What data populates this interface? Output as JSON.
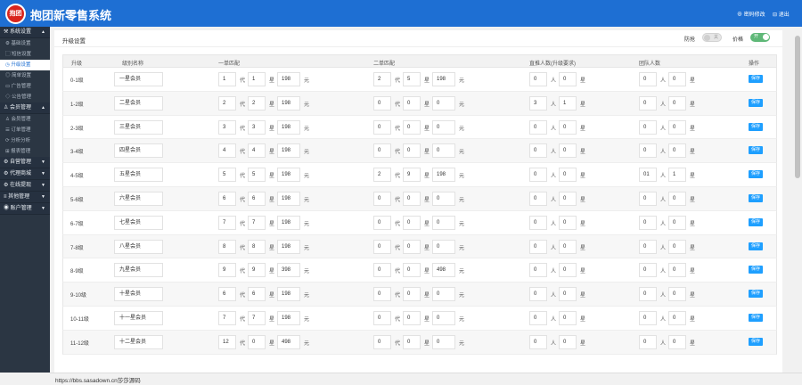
{
  "header": {
    "logo_text": "抱团",
    "title": "抱团新零售系统",
    "change_password": "⊕ 密码修改",
    "logout": "⊟ 退出"
  },
  "sidebar": {
    "items": [
      {
        "type": "group",
        "label": "⚒ 系统设置",
        "arrow": "▲"
      },
      {
        "type": "item",
        "label": "⚙ 基础设置"
      },
      {
        "type": "item",
        "label": "▢ 短信设置"
      },
      {
        "type": "item",
        "label": "◷ 升级设置",
        "active": true
      },
      {
        "type": "item",
        "label": "◎ 简单设置"
      },
      {
        "type": "item",
        "label": "▭ 广告管理"
      },
      {
        "type": "item",
        "label": "◇ 公告管理"
      },
      {
        "type": "group",
        "label": "♙ 会员管理",
        "arrow": "▲"
      },
      {
        "type": "item",
        "label": "♙ 会员管理"
      },
      {
        "type": "item",
        "label": "☰ 订单管理"
      },
      {
        "type": "item",
        "label": "⟳ 分析分析"
      },
      {
        "type": "item",
        "label": "⊞ 报表管理"
      },
      {
        "type": "group",
        "label": "⚙ 自营管理",
        "arrow": "▼"
      },
      {
        "type": "group",
        "label": "⚙ 代理商城",
        "arrow": "▼"
      },
      {
        "type": "group",
        "label": "⚙ 在线提现",
        "arrow": "▼"
      },
      {
        "type": "group",
        "label": "≡ 其他管理",
        "arrow": "▼"
      },
      {
        "type": "group",
        "label": "◉ 账户管理",
        "arrow": "▼"
      }
    ]
  },
  "page": {
    "title": "升级设置",
    "toggle1_label": "防抢",
    "toggle1_state": "关",
    "toggle2_label": "价格",
    "toggle2_state": "开"
  },
  "table": {
    "headers": [
      "升级",
      "级别名称",
      "一单匹配",
      "二单匹配",
      "直推人数(升级要求)",
      "团队人数",
      "操作"
    ],
    "save_label": "保存",
    "rows": [
      {
        "level": "0-1级",
        "name": "一星会员",
        "m1": [
          "1",
          "代",
          "1",
          "星",
          "198",
          "元"
        ],
        "m2": [
          "2",
          "代",
          "5",
          "星",
          "198",
          "元"
        ],
        "d": [
          "0",
          "人",
          "0",
          "星"
        ],
        "t": [
          "0",
          "人",
          "0",
          "星"
        ]
      },
      {
        "level": "1-2级",
        "name": "二星会员",
        "m1": [
          "2",
          "代",
          "2",
          "星",
          "198",
          "元"
        ],
        "m2": [
          "0",
          "代",
          "0",
          "星",
          "0",
          "元"
        ],
        "d": [
          "3",
          "人",
          "1",
          "星"
        ],
        "t": [
          "0",
          "人",
          "0",
          "星"
        ]
      },
      {
        "level": "2-3级",
        "name": "三星会员",
        "m1": [
          "3",
          "代",
          "3",
          "星",
          "198",
          "元"
        ],
        "m2": [
          "0",
          "代",
          "0",
          "星",
          "0",
          "元"
        ],
        "d": [
          "0",
          "人",
          "0",
          "星"
        ],
        "t": [
          "0",
          "人",
          "0",
          "星"
        ]
      },
      {
        "level": "3-4级",
        "name": "四星会员",
        "m1": [
          "4",
          "代",
          "4",
          "星",
          "198",
          "元"
        ],
        "m2": [
          "0",
          "代",
          "0",
          "星",
          "0",
          "元"
        ],
        "d": [
          "0",
          "人",
          "0",
          "星"
        ],
        "t": [
          "0",
          "人",
          "0",
          "星"
        ]
      },
      {
        "level": "4-5级",
        "name": "五星会员",
        "m1": [
          "5",
          "代",
          "5",
          "星",
          "198",
          "元"
        ],
        "m2": [
          "2",
          "代",
          "9",
          "星",
          "198",
          "元"
        ],
        "d": [
          "0",
          "人",
          "0",
          "星"
        ],
        "t": [
          "01",
          "人",
          "1",
          "星"
        ]
      },
      {
        "level": "5-6级",
        "name": "六星会员",
        "m1": [
          "6",
          "代",
          "6",
          "星",
          "198",
          "元"
        ],
        "m2": [
          "0",
          "代",
          "0",
          "星",
          "0",
          "元"
        ],
        "d": [
          "0",
          "人",
          "0",
          "星"
        ],
        "t": [
          "0",
          "人",
          "0",
          "星"
        ]
      },
      {
        "level": "6-7级",
        "name": "七星会员",
        "m1": [
          "7",
          "代",
          "7",
          "星",
          "198",
          "元"
        ],
        "m2": [
          "0",
          "代",
          "0",
          "星",
          "0",
          "元"
        ],
        "d": [
          "0",
          "人",
          "0",
          "星"
        ],
        "t": [
          "0",
          "人",
          "0",
          "星"
        ]
      },
      {
        "level": "7-8级",
        "name": "八星会员",
        "m1": [
          "8",
          "代",
          "8",
          "星",
          "198",
          "元"
        ],
        "m2": [
          "0",
          "代",
          "0",
          "星",
          "0",
          "元"
        ],
        "d": [
          "0",
          "人",
          "0",
          "星"
        ],
        "t": [
          "0",
          "人",
          "0",
          "星"
        ]
      },
      {
        "level": "8-9级",
        "name": "九星会员",
        "m1": [
          "9",
          "代",
          "9",
          "星",
          "398",
          "元"
        ],
        "m2": [
          "0",
          "代",
          "0",
          "星",
          "498",
          "元"
        ],
        "d": [
          "0",
          "人",
          "0",
          "星"
        ],
        "t": [
          "0",
          "人",
          "0",
          "星"
        ]
      },
      {
        "level": "9-10级",
        "name": "十星会员",
        "m1": [
          "6",
          "代",
          "6",
          "星",
          "198",
          "元"
        ],
        "m2": [
          "0",
          "代",
          "0",
          "星",
          "0",
          "元"
        ],
        "d": [
          "0",
          "人",
          "0",
          "星"
        ],
        "t": [
          "0",
          "人",
          "0",
          "星"
        ]
      },
      {
        "level": "10-11级",
        "name": "十一星会员",
        "m1": [
          "7",
          "代",
          "7",
          "星",
          "198",
          "元"
        ],
        "m2": [
          "0",
          "代",
          "0",
          "星",
          "0",
          "元"
        ],
        "d": [
          "0",
          "人",
          "0",
          "星"
        ],
        "t": [
          "0",
          "人",
          "0",
          "星"
        ]
      },
      {
        "level": "11-12级",
        "name": "十二星会员",
        "m1": [
          "12",
          "代",
          "0",
          "星",
          "498",
          "元"
        ],
        "m2": [
          "0",
          "代",
          "0",
          "星",
          "0",
          "元"
        ],
        "d": [
          "0",
          "人",
          "0",
          "星"
        ],
        "t": [
          "0",
          "人",
          "0",
          "星"
        ]
      }
    ]
  },
  "status": {
    "url": "https://bbs.sasadown.cn莎莎源码"
  }
}
